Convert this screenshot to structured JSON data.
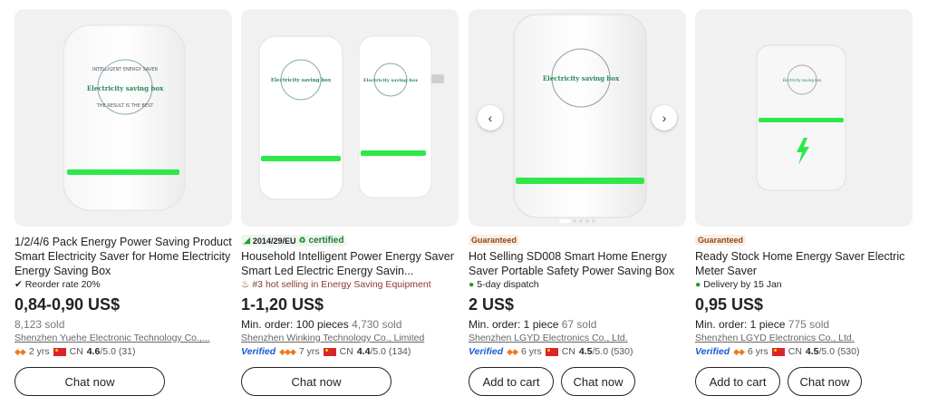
{
  "products": [
    {
      "title": "1/2/4/6 Pack Energy Power Saving Product Smart Electricity Saver for Home Electricity Energy Saving Box",
      "tagline": "Reorder rate 20%",
      "price": "0,84-0,90 US$",
      "sold": "8,123 sold",
      "supplier": "Shenzhen Yuehe Electronic Technology Co.,...",
      "years": "2 yrs",
      "country": "CN",
      "rating": "4.6",
      "rating_max": "/5.0 (31)",
      "chat_label": "Chat now",
      "image_text_1": "INTELLIGENT ENERGY SAVER",
      "image_text_2": "Electricity saving box",
      "image_text_3": "THE RESULT IS THE BEST"
    },
    {
      "badge_code": "2014/29/EU",
      "badge_cert": "certified",
      "title": "Household Intelligent Power Energy Saver Smart Led Electric Energy Savin...",
      "tagline": "#3 hot selling in Energy Saving Equipment",
      "price": "1-1,20 US$",
      "min_order_label": "Min. order: 100 pieces",
      "sold": "4,730 sold",
      "supplier": "Shenzhen Winking Technology Co., Limited",
      "verified": "Verified",
      "years": "7 yrs",
      "country": "CN",
      "rating": "4.4",
      "rating_max": "/5.0 (134)",
      "chat_label": "Chat now",
      "image_text_2": "Electricity saving box"
    },
    {
      "badge": "Guaranteed",
      "title": "Hot Selling SD008 Smart Home Energy Saver Portable Safety Power Saving Box",
      "tagline": "5-day dispatch",
      "price": "2 US$",
      "min_order_label": "Min. order: 1 piece",
      "sold": "67 sold",
      "supplier": "Shenzhen LGYD Electronics Co., Ltd.",
      "verified": "Verified",
      "years": "6 yrs",
      "country": "CN",
      "rating": "4.5",
      "rating_max": "/5.0 (530)",
      "cart_label": "Add to cart",
      "chat_label": "Chat now",
      "image_text_2": "Electricity saving box"
    },
    {
      "badge": "Guaranteed",
      "title": "Ready Stock Home Energy Saver Electric Meter Saver",
      "tagline": "Delivery by 15 Jan",
      "price": "0,95 US$",
      "min_order_label": "Min. order: 1 piece",
      "sold": "775 sold",
      "supplier": "Shenzhen LGYD Electronics Co., Ltd.",
      "verified": "Verified",
      "years": "6 yrs",
      "country": "CN",
      "rating": "4.5",
      "rating_max": "/5.0 (530)",
      "cart_label": "Add to cart",
      "chat_label": "Chat now"
    }
  ],
  "colors": {
    "accent_green": "#2ee84a",
    "verified_blue": "#1a5bd6",
    "guaranteed_bg": "#fdeee4"
  }
}
